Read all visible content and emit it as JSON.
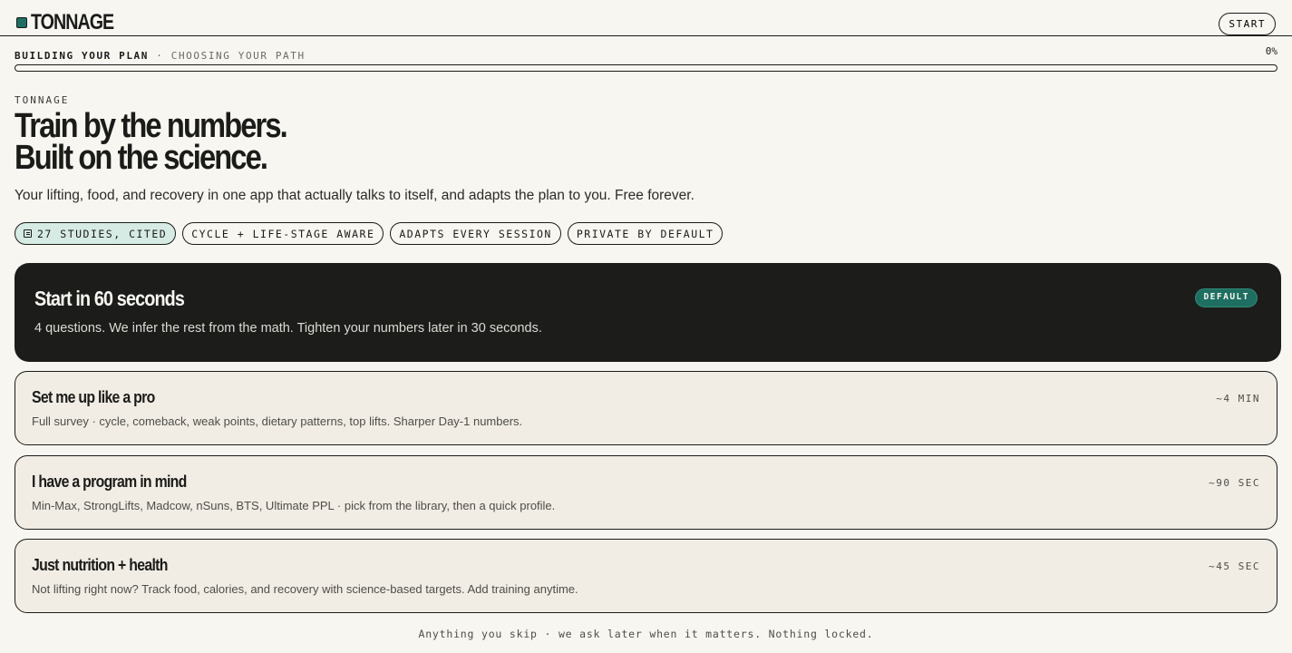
{
  "app": {
    "brand_name": "TONNAGE",
    "start_label": "START"
  },
  "progress": {
    "label": "BUILDING YOUR PLAN",
    "separator": "·",
    "sublabel": "CHOOSING YOUR PATH",
    "percent_text": "0%",
    "fraction": 0
  },
  "hero": {
    "eyebrow": "TONNAGE",
    "headline_line1": "Train by the numbers.",
    "headline_line2": "Built on the science.",
    "subtitle": "Your lifting, food, and recovery in one app that actually talks to itself, and adapts the plan to you. Free forever."
  },
  "chips": [
    {
      "label": "27 STUDIES, CITED",
      "icon": "document-icon"
    },
    {
      "label": "CYCLE + LIFE-STAGE AWARE"
    },
    {
      "label": "ADAPTS EVERY SESSION"
    },
    {
      "label": "PRIVATE BY DEFAULT"
    }
  ],
  "primary_option": {
    "title": "Start in 60 seconds",
    "description": "4 questions. We infer the rest from the math. Tighten your numbers later in 30 seconds.",
    "badge": "DEFAULT"
  },
  "options": [
    {
      "title": "Set me up like a pro",
      "description": "Full survey · cycle, comeback, weak points, dietary patterns, top lifts. Sharper Day-1 numbers.",
      "time": "~4 MIN"
    },
    {
      "title": "I have a program in mind",
      "description": "Min-Max, StrongLifts, Madcow, nSuns, BTS, Ultimate PPL · pick from the library, then a quick profile.",
      "time": "~90 SEC"
    },
    {
      "title": "Just nutrition + health",
      "description": "Not lifting right now? Track food, calories, and recovery with science-based targets. Add training anytime.",
      "time": "~45 SEC"
    }
  ],
  "footer_note": "Anything you skip · we ask later when it matters. Nothing locked.",
  "colors": {
    "accent": "#1e6f62",
    "background": "#f8f6f1",
    "ink": "#1b1b19",
    "card_dark": "#1c1c1a",
    "chip_accent": "#d6ebe4"
  }
}
